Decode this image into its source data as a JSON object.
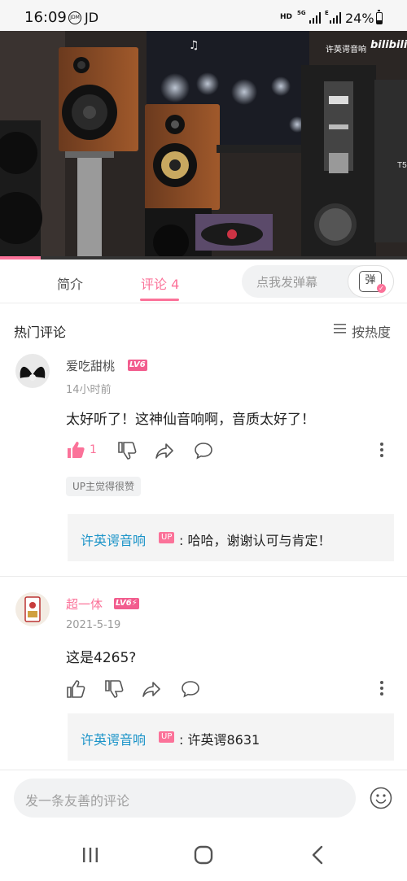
{
  "status_bar": {
    "time": "16:09",
    "carrier": "JD",
    "jdm_badge": "JDM",
    "hd": "HD",
    "net1": "5G",
    "net2": "E",
    "battery": "24%"
  },
  "video": {
    "watermark_name": "许英谔音响",
    "watermark_logo": "bilibili",
    "progress": 0.1
  },
  "tabs": [
    {
      "label": "简介",
      "active": false
    },
    {
      "label": "评论 4",
      "active": true
    }
  ],
  "danmaku": {
    "placeholder": "点我发弹幕",
    "button": "弹"
  },
  "comments_header": {
    "title": "热门评论",
    "sort": "按热度"
  },
  "comments": [
    {
      "user": "爱吃甜桃",
      "level": "LV6",
      "time": "14小时前",
      "text": "太好听了！这神仙音响啊，音质太好了！",
      "likes": "1",
      "tag": "UP主觉得很赞",
      "reply": {
        "user": "许英谔音响",
        "badge": "UP",
        "text": ": 哈哈，谢谢认可与肯定！"
      }
    },
    {
      "user": "超一体",
      "level": "LV6⚡",
      "time": "2021-5-19",
      "text": "这是4265?",
      "reply": {
        "user": "许英谔音响",
        "badge": "UP",
        "text": ": 许英谔8631"
      }
    }
  ],
  "comment_input": {
    "placeholder": "发一条友善的评论"
  },
  "colors": {
    "accent": "#fb7299",
    "link": "#1a93c8",
    "level": "#f25d8e"
  }
}
